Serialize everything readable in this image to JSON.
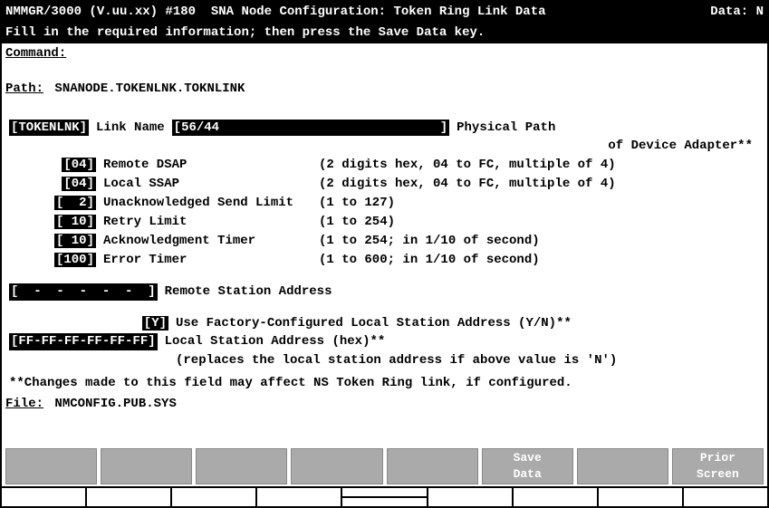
{
  "header": {
    "left": "NMMGR/3000 (V.uu.xx) #180  SNA Node Configuration: Token Ring Link Data",
    "right": "Data: N"
  },
  "instruction": "Fill in the required information; then press the Save Data key.",
  "command_label": "Command:",
  "command_value": "",
  "path_label": "Path:",
  "path_value": "SNANODE.TOKENLNK.TOKNLINK",
  "fields": {
    "link_name": {
      "value": "TOKENLNK",
      "label": "Link Name",
      "phys_value": "56/44",
      "phys_desc1": "Physical Path",
      "phys_desc2": "of Device Adapter**"
    },
    "remote_dsap": {
      "value": "04",
      "label": "Remote DSAP",
      "help": "(2 digits hex, 04 to FC, multiple of 4)"
    },
    "local_ssap": {
      "value": "04",
      "label": "Local SSAP",
      "help": "(2 digits hex, 04 to FC, multiple of 4)"
    },
    "unack": {
      "value": "  2",
      "label": "Unacknowledged Send Limit",
      "help": "(1 to 127)"
    },
    "retry": {
      "value": " 10",
      "label": "Retry Limit",
      "help": "(1 to 254)"
    },
    "ack_timer": {
      "value": " 10",
      "label": "Acknowledgment Timer",
      "help": "(1 to 254; in 1/10 of second)"
    },
    "err_timer": {
      "value": "100",
      "label": "Error Timer",
      "help": "(1 to 600; in 1/10 of second)"
    },
    "remote_addr": {
      "value": "  -  -  -  -  -  ",
      "label": "Remote Station Address"
    },
    "use_factory": {
      "value": "Y",
      "label": "Use Factory-Configured Local Station Address (Y/N)**"
    },
    "local_addr": {
      "value": "FF-FF-FF-FF-FF-FF",
      "label": "Local Station Address (hex)**",
      "sub": "(replaces the local station address if above value is 'N')"
    }
  },
  "note": "**Changes made to this field may affect NS Token Ring link, if configured.",
  "file_label": "File:",
  "file_value": "NMCONFIG.PUB.SYS",
  "fkeys": {
    "f1": "",
    "f2": "",
    "f3": "",
    "f4": "",
    "f5": "",
    "f6_line1": "Save",
    "f6_line2": "Data",
    "f7": "",
    "f8_line1": "Prior",
    "f8_line2": "Screen"
  }
}
